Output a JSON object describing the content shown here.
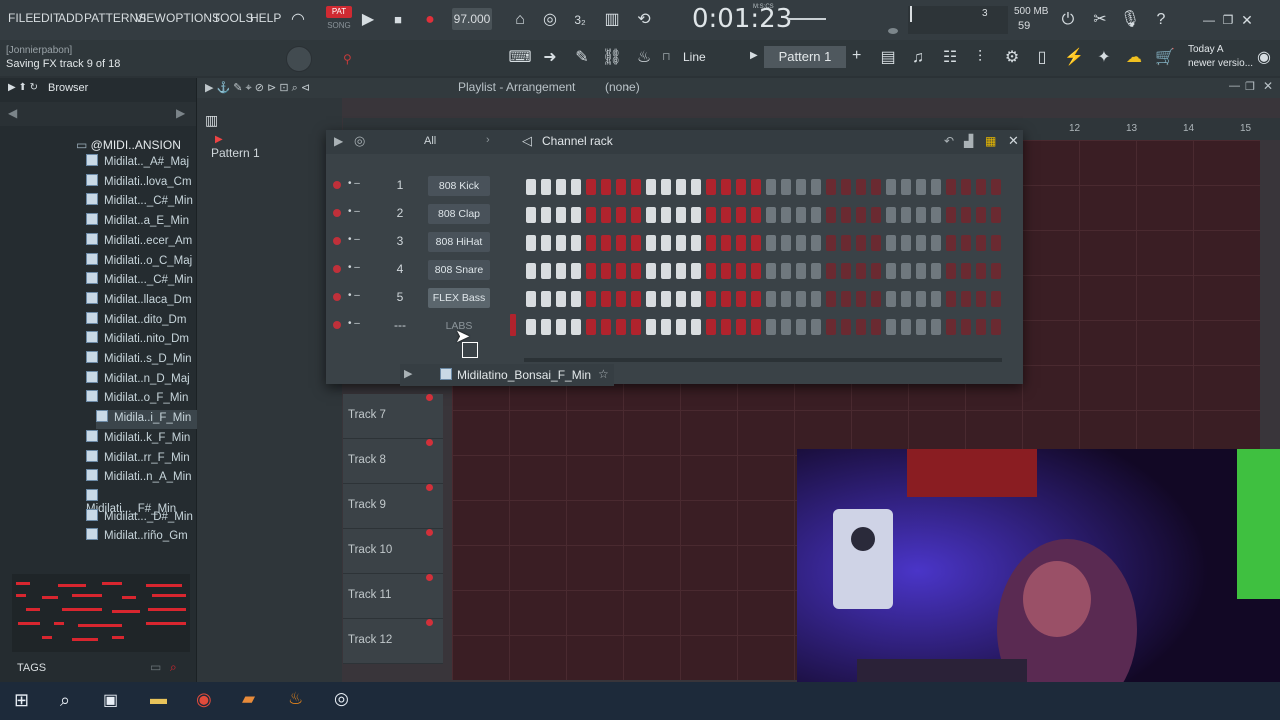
{
  "menu": [
    "FILE",
    "EDIT",
    "ADD",
    "PATTERNS",
    "VIEW",
    "OPTIONS",
    "TOOLS",
    "HELP"
  ],
  "transport": {
    "mode_label": "PAT",
    "song_label": "SONG",
    "tempo": "97.000",
    "time": "0:01:23",
    "time_unit": "M:S:CS",
    "cpu": "3",
    "ram": "500 MB",
    "poly": "59"
  },
  "hint": {
    "user": "[Jonnierpabon]",
    "status": "Saving FX track 9 of 18",
    "news_line1": "Today  A",
    "news_line2": "newer versio..."
  },
  "toolbar2": {
    "snap": "Line",
    "pattern": "Pattern 1"
  },
  "browser": {
    "title": "Browser",
    "folder": "@MIDI..ANSION",
    "tags_label": "TAGS",
    "items": [
      "Midilat.._A#_Maj",
      "Midilati..lova_Cm",
      "Midilat..._C#_Min",
      "Midilat..a_E_Min",
      "Midilati..ecer_Am",
      "Midilati..o_C_Maj",
      "Midilat..._C#_Min",
      "Midilat..llaca_Dm",
      "Midilat..dito_Dm",
      "Midilati..nito_Dm",
      "Midilati..s_D_Min",
      "Midilat..n_D_Maj",
      "Midilat..o_F_Min",
      "Midila..i_F_Min",
      "Midilati..k_F_Min",
      "Midilat..rr_F_Min",
      "Midilati..n_A_Min",
      "Midilati..._F#_Min",
      "Midilat..._D#_Min",
      "Midilat..riño_Gm"
    ]
  },
  "playlist": {
    "title": "Playlist - Arrangement",
    "sub": "(none)",
    "pattern_item": "Pattern 1",
    "ruler": [
      "12",
      "13",
      "14",
      "15"
    ],
    "tracks": [
      "Track 7",
      "Track 8",
      "Track 9",
      "Track 10",
      "Track 11",
      "Track 12"
    ]
  },
  "rack": {
    "title": "Channel rack",
    "filter": "All",
    "channels": [
      {
        "num": "1",
        "name": "808 Kick"
      },
      {
        "num": "2",
        "name": "808 Clap"
      },
      {
        "num": "3",
        "name": "808 HiHat"
      },
      {
        "num": "4",
        "name": "808 Snare"
      },
      {
        "num": "5",
        "name": "FLEX Bass"
      },
      {
        "num": "---",
        "name": "LABS"
      }
    ],
    "steps_pattern": "ggggrrrrggggrrrrggggrrrrggggrrrr",
    "drag_file": "Midilatino_Bonsai_F_Min"
  },
  "colors": {
    "accent_red": "#b0232d",
    "step_light": "#d9dde0",
    "grid_bg": "#3a1e24"
  }
}
